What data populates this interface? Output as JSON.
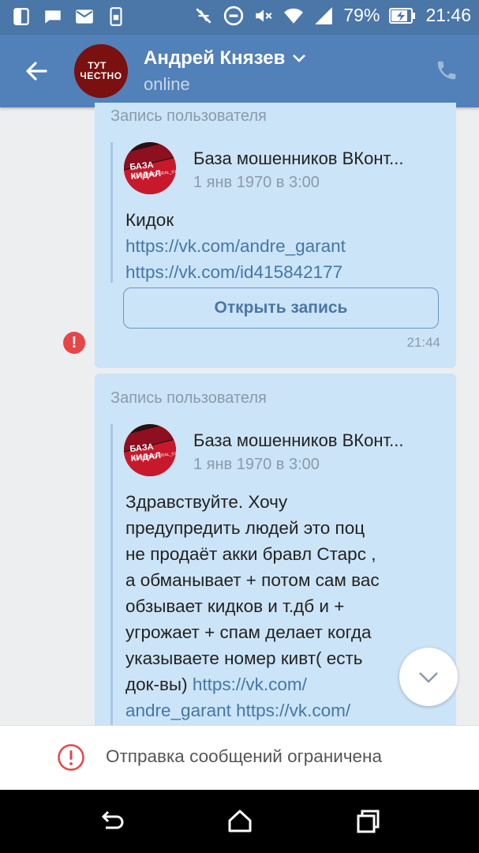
{
  "status_bar": {
    "battery": "79%",
    "time": "21:46"
  },
  "header": {
    "name": "Андрей Князев",
    "status": "online",
    "avatar_line1": "ТУТ",
    "avatar_line2": "ЧЕСТНО"
  },
  "messages": [
    {
      "label": "Запись пользователя",
      "author": "База мошенников ВКонт...",
      "date": "1 янв 1970 в 3:00",
      "avatar_text": "БАЗА КИДАЛ",
      "text": "Кидок",
      "links": [
        "https://vk.com/andre_garant",
        "https://vk.com/id415842177"
      ],
      "button": "Открыть запись",
      "time": "21:44"
    },
    {
      "label": "Запись пользователя",
      "author": "База мошенников ВКонт...",
      "date": "1 янв 1970 в 3:00",
      "avatar_text": "БАЗА КИДАЛ",
      "lines": [
        "Здравствуйте. Хочу",
        "предупредить людей это поц",
        "не продаёт акки бравл Старс ,",
        "а обманывает + потом сам вас",
        "обзывает кидков и т.дб и +",
        "угрожает + спам делает когда",
        "указываете номер кивт( есть"
      ],
      "line8_text": "док-вы)",
      "line8_link": "https://vk.com/",
      "line9_link1": "andre_garant",
      "line9_link2": "https://vk.com/"
    }
  ],
  "error_mark": "!",
  "restriction": {
    "text": "Отправка сообщений ограничена"
  },
  "colors": {
    "header": "#5181b8",
    "status_bar": "#4a76a8",
    "bubble": "#cce4f7",
    "link": "#4477a8",
    "error": "#e64646"
  }
}
